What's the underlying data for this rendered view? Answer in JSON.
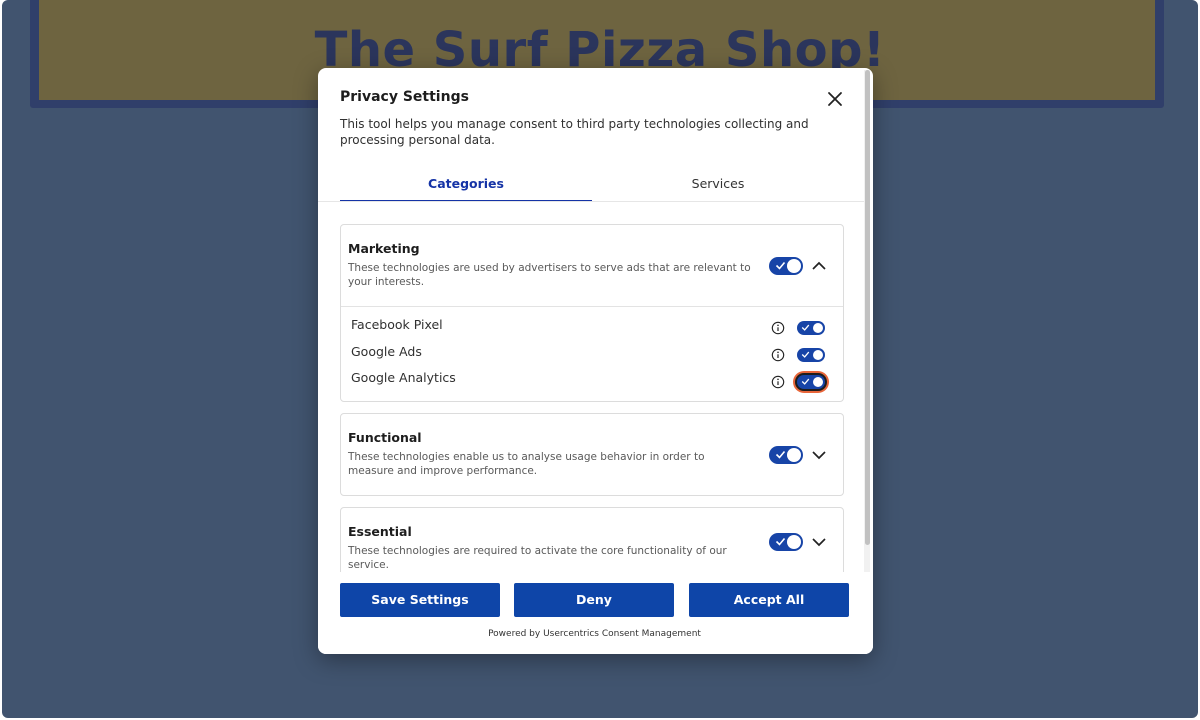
{
  "site": {
    "title": "The Surf Pizza Shop!"
  },
  "modal": {
    "title": "Privacy Settings",
    "description": "This tool helps you manage consent to third party technologies collecting and processing personal data.",
    "tabs": [
      {
        "label": "Categories",
        "active": true
      },
      {
        "label": "Services",
        "active": false
      }
    ],
    "categories": [
      {
        "title": "Marketing",
        "description": "These technologies are used by advertisers to serve ads that are relevant to your interests.",
        "enabled": true,
        "expanded": true,
        "services": [
          {
            "name": "Facebook Pixel",
            "enabled": true
          },
          {
            "name": "Google Ads",
            "enabled": true
          },
          {
            "name": "Google Analytics",
            "enabled": true,
            "focused": true
          }
        ]
      },
      {
        "title": "Functional",
        "description": "These technologies enable us to analyse usage behavior in order to measure and improve performance.",
        "enabled": true,
        "expanded": false
      },
      {
        "title": "Essential",
        "description": "These technologies are required to activate the core functionality of our service.",
        "enabled": true,
        "expanded": false
      }
    ],
    "buttons": {
      "save": "Save Settings",
      "deny": "Deny",
      "accept": "Accept All"
    },
    "powered_by": "Powered by Usercentrics Consent Management"
  },
  "colors": {
    "accent": "#0e45a8",
    "toggle_on": "#1744a7",
    "focus_ring": "#e8663a",
    "backdrop": "#41546f"
  },
  "icons": {
    "close": "close-icon",
    "chevron_up": "chevron-up-icon",
    "chevron_down": "chevron-down-icon",
    "info": "info-icon",
    "check": "check-icon"
  }
}
